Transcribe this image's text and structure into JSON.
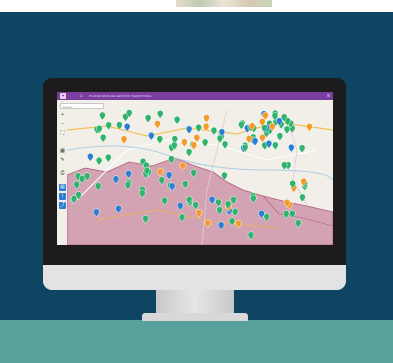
{
  "app": {
    "logo_glyph": "✦",
    "home_glyph": "⌂",
    "title": "PLATAFORMA DE GESTIÓN TERRITORIAL",
    "menu_glyph": "≡"
  },
  "search": {
    "placeholder": "Buscar..."
  },
  "toolbar": {
    "tools": [
      {
        "name": "zoom-in-icon",
        "glyph": "+"
      },
      {
        "name": "zoom-out-icon",
        "glyph": "−"
      },
      {
        "name": "extent-icon",
        "glyph": "⛶"
      },
      {
        "name": "layers-icon",
        "glyph": "▦"
      },
      {
        "name": "measure-icon",
        "glyph": "✎"
      },
      {
        "name": "print-icon",
        "glyph": "⎙"
      },
      {
        "name": "table-icon",
        "glyph": "▤"
      },
      {
        "name": "info-icon",
        "glyph": "i"
      },
      {
        "name": "share-icon",
        "glyph": "⤴"
      }
    ]
  },
  "colors": {
    "background": "#0f4463",
    "floor": "#57a19d",
    "header": "#7a3ea1",
    "marker_green": "#2fb36d",
    "marker_orange": "#f39a2b",
    "marker_blue": "#2a7fd4",
    "region_fill": "#c98aa0"
  }
}
